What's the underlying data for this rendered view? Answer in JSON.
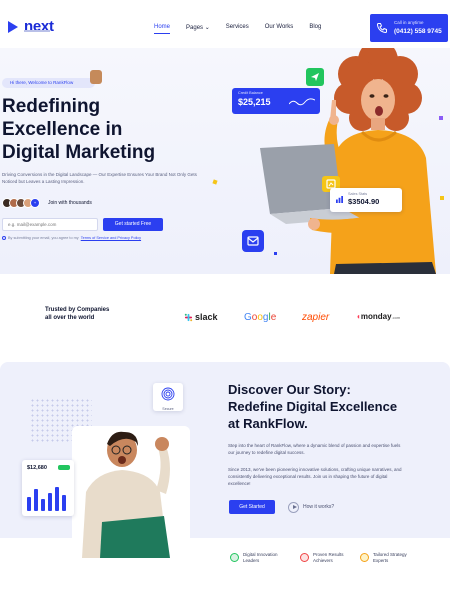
{
  "header": {
    "logo_text": "next",
    "nav": [
      "Home",
      "Pages",
      "Services",
      "Our Works",
      "Blog"
    ],
    "call_label": "Call in anytime",
    "call_number": "(0412) 558 9745"
  },
  "hero": {
    "welcome": "Hi there, Welcome to RankFlow",
    "title_lines": [
      "Redefining",
      "Excellence in",
      "Digital Marketing"
    ],
    "description": "Driving Conversions in the Digital Landscape — Our Expertise Ensures Your Brand Not Only Gets Noticed but Leaves a Lasting Impression.",
    "avatars_badge": "+",
    "join_text": "Join with thousands",
    "email_placeholder": "e.g. mail@example.com",
    "cta_label": "Get started Free",
    "terms_prefix": "By submitting your email, you agree to my",
    "terms_link": "Terms of Service and Privacy Policy",
    "balance_label": "Credit Balance",
    "balance_value": "$25,215",
    "sales_label": "Sales Stats",
    "sales_value": "$3504.90"
  },
  "trusted": {
    "text": "Trusted by Companies all over the world",
    "brands": {
      "slack": "slack",
      "google": [
        "G",
        "o",
        "o",
        "g",
        "l",
        "e"
      ],
      "zapier": "zapier",
      "monday": "monday",
      "monday_suffix": ".com"
    },
    "google_colors": [
      "#4285F4",
      "#EA4335",
      "#FBBC05",
      "#4285F4",
      "#34A853",
      "#EA4335"
    ]
  },
  "about": {
    "secure_label": "Secure",
    "stats_value": "$12,680",
    "title_lines": [
      "Discover Our Story:",
      "Redefine Digital Excellence",
      "at RankFlow."
    ],
    "para1": "Step into the heart of RankFlow, where a dynamic blend of passion and expertise fuels our journey to redefine digital success.",
    "para2": "Since 2013, we've been pioneering innovative solutions, crafting unique narratives, and consistently delivering exceptional results. Join us in shaping the future of digital excellence!",
    "cta_label": "Get Started",
    "how_label": "How it works?",
    "features": [
      "Digital Innovation Leaders",
      "Proven Results Achievers",
      "Tailored Strategy Experts"
    ]
  },
  "colors": {
    "accent": "#2b3ff0",
    "dark": "#0f1530",
    "hero_bg": "#f3f4fc"
  }
}
